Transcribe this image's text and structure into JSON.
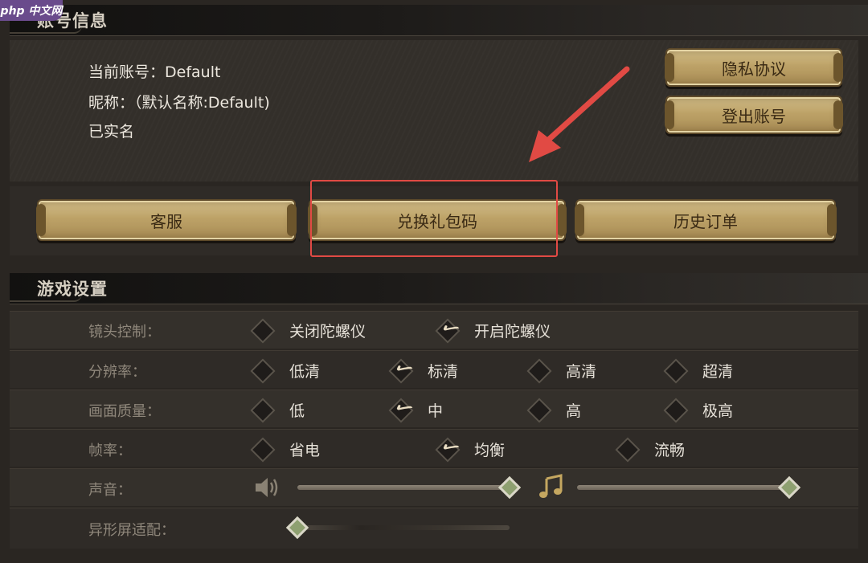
{
  "watermark": "php 中文网",
  "account": {
    "section_title": "账号信息",
    "current_account": "当前账号：Default",
    "nickname": "昵称：（默认名称:Default)",
    "verified": "已实名",
    "privacy_button": "隐私协议",
    "logout_button": "登出账号",
    "support_button": "客服",
    "redeem_button": "兑换礼包码",
    "history_button": "历史订单"
  },
  "settings": {
    "section_title": "游戏设置",
    "camera": {
      "label": "镜头控制：",
      "options": [
        "关闭陀螺仪",
        "开启陀螺仪"
      ],
      "selected": 1
    },
    "resolution": {
      "label": "分辨率：",
      "options": [
        "低清",
        "标清",
        "高清",
        "超清"
      ],
      "selected": 1
    },
    "quality": {
      "label": "画面质量：",
      "options": [
        "低",
        "中",
        "高",
        "极高"
      ],
      "selected": 1
    },
    "framerate": {
      "label": "帧率：",
      "options": [
        "省电",
        "均衡",
        "流畅"
      ],
      "selected": 1
    },
    "sound": {
      "label": "声音：",
      "sfx_level": 1.0,
      "music_level": 1.0
    },
    "notch": {
      "label": "异形屏适配：",
      "level": 0.0
    }
  },
  "icons": [
    "search-icon",
    "speaker-icon",
    "music-note-icon",
    "checkmark-icon",
    "annotation-arrow-icon"
  ],
  "colors": {
    "highlight": "#e14a44",
    "gold": "#c9b27a"
  }
}
